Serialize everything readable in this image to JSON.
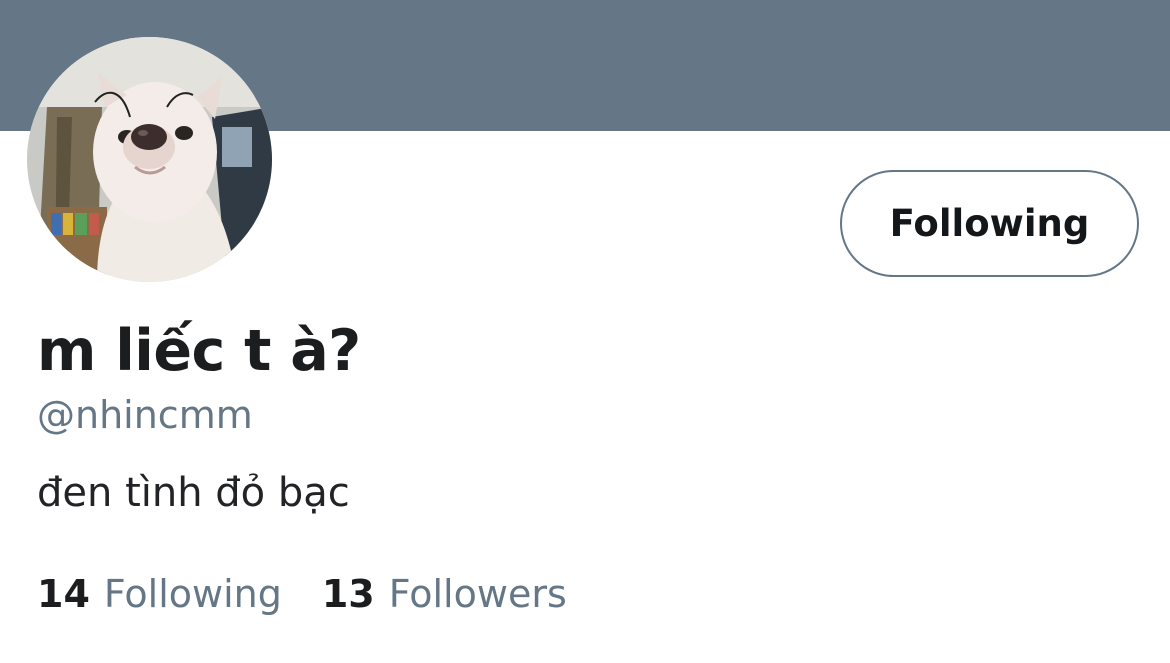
{
  "profile": {
    "display_name": "m liếc t à?",
    "handle": "@nhincmm",
    "bio": "đen tình đỏ bạc",
    "avatar_icon": "dog-avatar-photo",
    "follow_button_label": "Following",
    "stats": {
      "following_count": "14",
      "following_label": "Following",
      "followers_count": "13",
      "followers_label": "Followers"
    }
  },
  "colors": {
    "banner": "#657786",
    "secondary_text": "#657786",
    "primary_text": "#1c1d1f"
  }
}
